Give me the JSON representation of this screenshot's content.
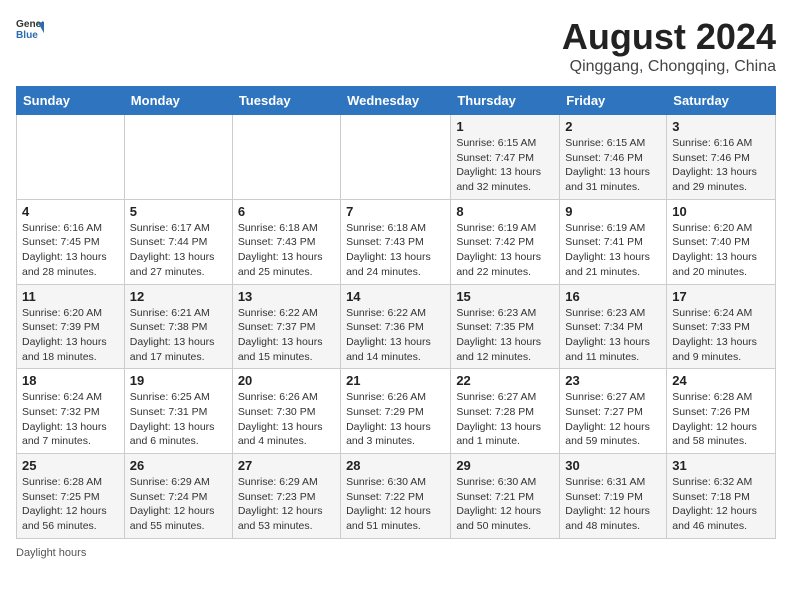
{
  "header": {
    "logo_general": "General",
    "logo_blue": "Blue",
    "title": "August 2024",
    "subtitle": "Qinggang, Chongqing, China"
  },
  "weekdays": [
    "Sunday",
    "Monday",
    "Tuesday",
    "Wednesday",
    "Thursday",
    "Friday",
    "Saturday"
  ],
  "weeks": [
    [
      {
        "day": "",
        "info": ""
      },
      {
        "day": "",
        "info": ""
      },
      {
        "day": "",
        "info": ""
      },
      {
        "day": "",
        "info": ""
      },
      {
        "day": "1",
        "info": "Sunrise: 6:15 AM\nSunset: 7:47 PM\nDaylight: 13 hours\nand 32 minutes."
      },
      {
        "day": "2",
        "info": "Sunrise: 6:15 AM\nSunset: 7:46 PM\nDaylight: 13 hours\nand 31 minutes."
      },
      {
        "day": "3",
        "info": "Sunrise: 6:16 AM\nSunset: 7:46 PM\nDaylight: 13 hours\nand 29 minutes."
      }
    ],
    [
      {
        "day": "4",
        "info": "Sunrise: 6:16 AM\nSunset: 7:45 PM\nDaylight: 13 hours\nand 28 minutes."
      },
      {
        "day": "5",
        "info": "Sunrise: 6:17 AM\nSunset: 7:44 PM\nDaylight: 13 hours\nand 27 minutes."
      },
      {
        "day": "6",
        "info": "Sunrise: 6:18 AM\nSunset: 7:43 PM\nDaylight: 13 hours\nand 25 minutes."
      },
      {
        "day": "7",
        "info": "Sunrise: 6:18 AM\nSunset: 7:43 PM\nDaylight: 13 hours\nand 24 minutes."
      },
      {
        "day": "8",
        "info": "Sunrise: 6:19 AM\nSunset: 7:42 PM\nDaylight: 13 hours\nand 22 minutes."
      },
      {
        "day": "9",
        "info": "Sunrise: 6:19 AM\nSunset: 7:41 PM\nDaylight: 13 hours\nand 21 minutes."
      },
      {
        "day": "10",
        "info": "Sunrise: 6:20 AM\nSunset: 7:40 PM\nDaylight: 13 hours\nand 20 minutes."
      }
    ],
    [
      {
        "day": "11",
        "info": "Sunrise: 6:20 AM\nSunset: 7:39 PM\nDaylight: 13 hours\nand 18 minutes."
      },
      {
        "day": "12",
        "info": "Sunrise: 6:21 AM\nSunset: 7:38 PM\nDaylight: 13 hours\nand 17 minutes."
      },
      {
        "day": "13",
        "info": "Sunrise: 6:22 AM\nSunset: 7:37 PM\nDaylight: 13 hours\nand 15 minutes."
      },
      {
        "day": "14",
        "info": "Sunrise: 6:22 AM\nSunset: 7:36 PM\nDaylight: 13 hours\nand 14 minutes."
      },
      {
        "day": "15",
        "info": "Sunrise: 6:23 AM\nSunset: 7:35 PM\nDaylight: 13 hours\nand 12 minutes."
      },
      {
        "day": "16",
        "info": "Sunrise: 6:23 AM\nSunset: 7:34 PM\nDaylight: 13 hours\nand 11 minutes."
      },
      {
        "day": "17",
        "info": "Sunrise: 6:24 AM\nSunset: 7:33 PM\nDaylight: 13 hours\nand 9 minutes."
      }
    ],
    [
      {
        "day": "18",
        "info": "Sunrise: 6:24 AM\nSunset: 7:32 PM\nDaylight: 13 hours\nand 7 minutes."
      },
      {
        "day": "19",
        "info": "Sunrise: 6:25 AM\nSunset: 7:31 PM\nDaylight: 13 hours\nand 6 minutes."
      },
      {
        "day": "20",
        "info": "Sunrise: 6:26 AM\nSunset: 7:30 PM\nDaylight: 13 hours\nand 4 minutes."
      },
      {
        "day": "21",
        "info": "Sunrise: 6:26 AM\nSunset: 7:29 PM\nDaylight: 13 hours\nand 3 minutes."
      },
      {
        "day": "22",
        "info": "Sunrise: 6:27 AM\nSunset: 7:28 PM\nDaylight: 13 hours\nand 1 minute."
      },
      {
        "day": "23",
        "info": "Sunrise: 6:27 AM\nSunset: 7:27 PM\nDaylight: 12 hours\nand 59 minutes."
      },
      {
        "day": "24",
        "info": "Sunrise: 6:28 AM\nSunset: 7:26 PM\nDaylight: 12 hours\nand 58 minutes."
      }
    ],
    [
      {
        "day": "25",
        "info": "Sunrise: 6:28 AM\nSunset: 7:25 PM\nDaylight: 12 hours\nand 56 minutes."
      },
      {
        "day": "26",
        "info": "Sunrise: 6:29 AM\nSunset: 7:24 PM\nDaylight: 12 hours\nand 55 minutes."
      },
      {
        "day": "27",
        "info": "Sunrise: 6:29 AM\nSunset: 7:23 PM\nDaylight: 12 hours\nand 53 minutes."
      },
      {
        "day": "28",
        "info": "Sunrise: 6:30 AM\nSunset: 7:22 PM\nDaylight: 12 hours\nand 51 minutes."
      },
      {
        "day": "29",
        "info": "Sunrise: 6:30 AM\nSunset: 7:21 PM\nDaylight: 12 hours\nand 50 minutes."
      },
      {
        "day": "30",
        "info": "Sunrise: 6:31 AM\nSunset: 7:19 PM\nDaylight: 12 hours\nand 48 minutes."
      },
      {
        "day": "31",
        "info": "Sunrise: 6:32 AM\nSunset: 7:18 PM\nDaylight: 12 hours\nand 46 minutes."
      }
    ]
  ],
  "footer": {
    "daylight_hours_label": "Daylight hours"
  }
}
